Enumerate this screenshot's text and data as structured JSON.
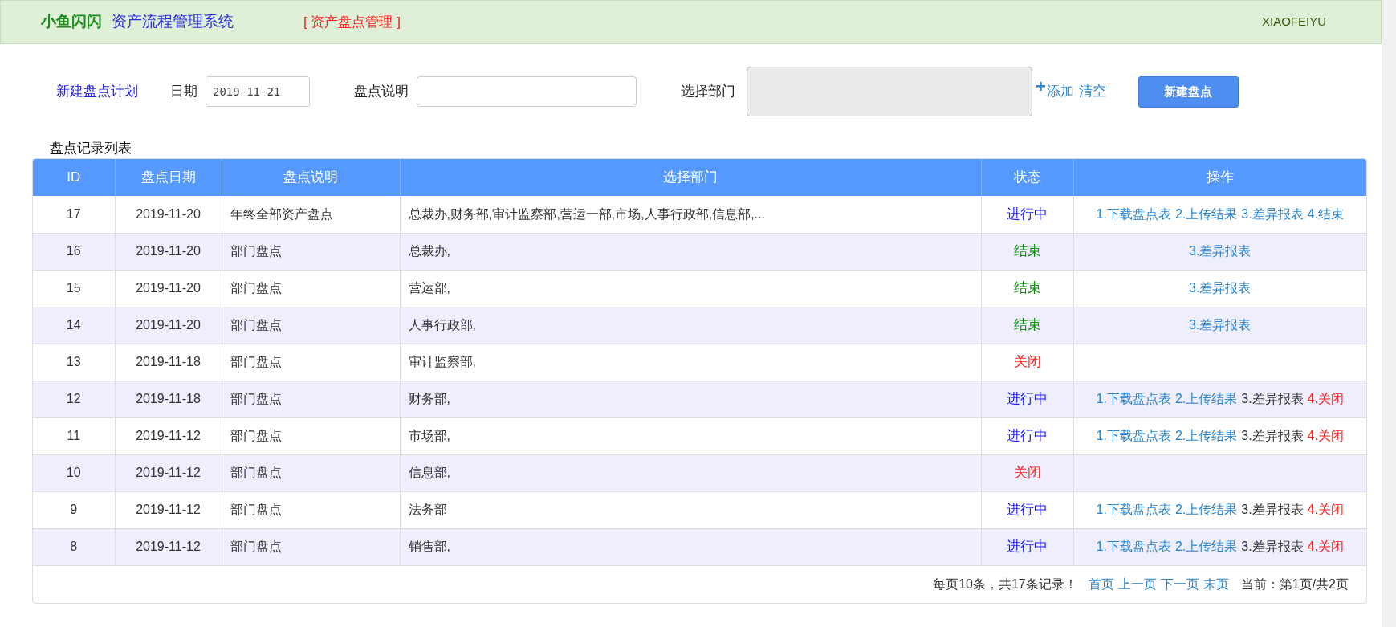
{
  "header": {
    "brand": "小鱼闪闪",
    "system": "资产流程管理系统",
    "module": "[ 资产盘点管理 ]",
    "user": "XIAOFEIYU"
  },
  "form": {
    "new_plan_link": "新建盘点计划",
    "date_label": "日期",
    "date_value": "2019-11-21",
    "desc_label": "盘点说明",
    "dept_label": "选择部门",
    "add_icon": "+",
    "add_link": "添加",
    "clear_link": "清空",
    "submit_button": "新建盘点"
  },
  "table": {
    "title": "盘点记录列表",
    "columns": [
      "ID",
      "盘点日期",
      "盘点说明",
      "选择部门",
      "状态",
      "操作"
    ],
    "rows": [
      {
        "id": "17",
        "date": "2019-11-20",
        "desc": "年终全部资产盘点",
        "dept": "总裁办,财务部,审计监察部,营运一部,市场,人事行政部,信息部,...",
        "status": "进行中",
        "kind": "active",
        "actions": [
          {
            "label": "1.下载盘点表",
            "kind": "link"
          },
          {
            "label": "2.上传结果",
            "kind": "link"
          },
          {
            "label": "3.差异报表",
            "kind": "link"
          },
          {
            "label": "4.结束",
            "kind": "link"
          }
        ]
      },
      {
        "id": "16",
        "date": "2019-11-20",
        "desc": "部门盘点",
        "dept": "总裁办,",
        "status": "结束",
        "kind": "done",
        "actions": [
          {
            "label": "3.差异报表",
            "kind": "link"
          }
        ]
      },
      {
        "id": "15",
        "date": "2019-11-20",
        "desc": "部门盘点",
        "dept": "营运部,",
        "status": "结束",
        "kind": "done",
        "actions": [
          {
            "label": "3.差异报表",
            "kind": "link"
          }
        ]
      },
      {
        "id": "14",
        "date": "2019-11-20",
        "desc": "部门盘点",
        "dept": "人事行政部,",
        "status": "结束",
        "kind": "done",
        "actions": [
          {
            "label": "3.差异报表",
            "kind": "link"
          }
        ]
      },
      {
        "id": "13",
        "date": "2019-11-18",
        "desc": "部门盘点",
        "dept": "审计监察部,",
        "status": "关闭",
        "kind": "closed",
        "actions": []
      },
      {
        "id": "12",
        "date": "2019-11-18",
        "desc": "部门盘点",
        "dept": "财务部,",
        "status": "进行中",
        "kind": "active",
        "actions": [
          {
            "label": "1.下载盘点表",
            "kind": "link"
          },
          {
            "label": "2.上传结果",
            "kind": "link"
          },
          {
            "label": "3.差异报表",
            "kind": "plain"
          },
          {
            "label": "4.关闭",
            "kind": "danger"
          }
        ]
      },
      {
        "id": "11",
        "date": "2019-11-12",
        "desc": "部门盘点",
        "dept": "市场部,",
        "status": "进行中",
        "kind": "active",
        "actions": [
          {
            "label": "1.下载盘点表",
            "kind": "link"
          },
          {
            "label": "2.上传结果",
            "kind": "link"
          },
          {
            "label": "3.差异报表",
            "kind": "plain"
          },
          {
            "label": "4.关闭",
            "kind": "danger"
          }
        ]
      },
      {
        "id": "10",
        "date": "2019-11-12",
        "desc": "部门盘点",
        "dept": "信息部,",
        "status": "关闭",
        "kind": "closed",
        "actions": []
      },
      {
        "id": "9",
        "date": "2019-11-12",
        "desc": "部门盘点",
        "dept": "法务部",
        "status": "进行中",
        "kind": "active",
        "actions": [
          {
            "label": "1.下载盘点表",
            "kind": "link"
          },
          {
            "label": "2.上传结果",
            "kind": "link"
          },
          {
            "label": "3.差异报表",
            "kind": "plain"
          },
          {
            "label": "4.关闭",
            "kind": "danger"
          }
        ]
      },
      {
        "id": "8",
        "date": "2019-11-12",
        "desc": "部门盘点",
        "dept": "销售部,",
        "status": "进行中",
        "kind": "active",
        "actions": [
          {
            "label": "1.下载盘点表",
            "kind": "link"
          },
          {
            "label": "2.上传结果",
            "kind": "link"
          },
          {
            "label": "3.差异报表",
            "kind": "plain"
          },
          {
            "label": "4.关闭",
            "kind": "danger"
          }
        ]
      }
    ]
  },
  "pagination": {
    "summary": "每页10条，共17条记录！",
    "links": [
      "首页",
      "上一页",
      "下一页",
      "末页"
    ],
    "current": "当前：第1页/共2页"
  }
}
